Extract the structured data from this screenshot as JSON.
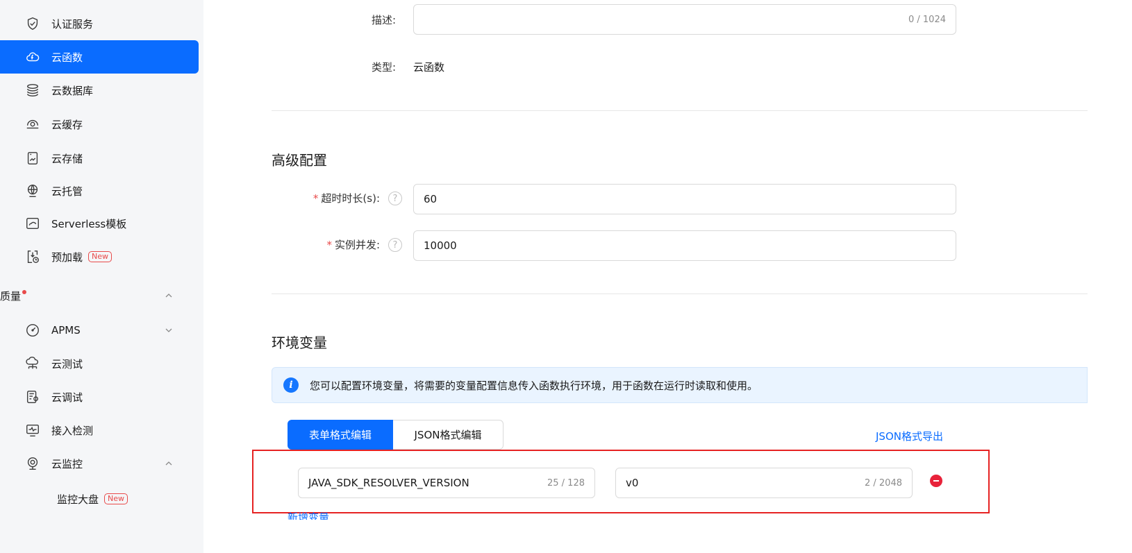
{
  "sidebar": {
    "items": [
      {
        "label": "认证服务",
        "icon": "shield-check-icon"
      },
      {
        "label": "云函数",
        "icon": "cloud-function-icon",
        "active": true
      },
      {
        "label": "云数据库",
        "icon": "database-layers-icon"
      },
      {
        "label": "云缓存",
        "icon": "cloud-cache-icon"
      },
      {
        "label": "云存储",
        "icon": "storage-icon"
      },
      {
        "label": "云托管",
        "icon": "globe-hosting-icon"
      },
      {
        "label": "Serverless模板",
        "icon": "template-icon"
      },
      {
        "label": "预加载",
        "icon": "preload-icon",
        "badge": "New"
      }
    ],
    "group": {
      "label": "质量"
    },
    "quality_items": [
      {
        "label": "APMS",
        "icon": "gauge-icon"
      },
      {
        "label": "云测试",
        "icon": "cloud-test-icon"
      },
      {
        "label": "云调试",
        "icon": "debug-icon"
      },
      {
        "label": "接入检测",
        "icon": "monitor-check-icon"
      },
      {
        "label": "云监控",
        "icon": "camera-monitor-icon"
      }
    ],
    "sub_items": [
      {
        "label": "监控大盘",
        "badge": "New"
      }
    ]
  },
  "form": {
    "description_label": "描述:",
    "description_counter": "0 / 1024",
    "type_label": "类型:",
    "type_value": "云函数"
  },
  "advanced": {
    "title": "高级配置",
    "timeout_label": "超时时长(s):",
    "timeout_value": "60",
    "concurrency_label": "实例并发:",
    "concurrency_value": "10000",
    "required_mark": "*",
    "help_glyph": "?"
  },
  "env": {
    "title": "环境变量",
    "info_text": "您可以配置环境变量，将需要的变量配置信息传入函数执行环境，用于函数在运行时读取和使用。",
    "info_glyph": "i",
    "tab_form": "表单格式编辑",
    "tab_json": "JSON格式编辑",
    "export_label": "JSON格式导出",
    "var_key": "JAVA_SDK_RESOLVER_VERSION",
    "var_key_counter": "25 / 128",
    "var_value": "v0",
    "var_value_counter": "2 / 2048",
    "add_label": "新增变量"
  },
  "colors": {
    "accent": "#0a6cff",
    "highlight": "#e62222",
    "danger": "#e8223a"
  }
}
